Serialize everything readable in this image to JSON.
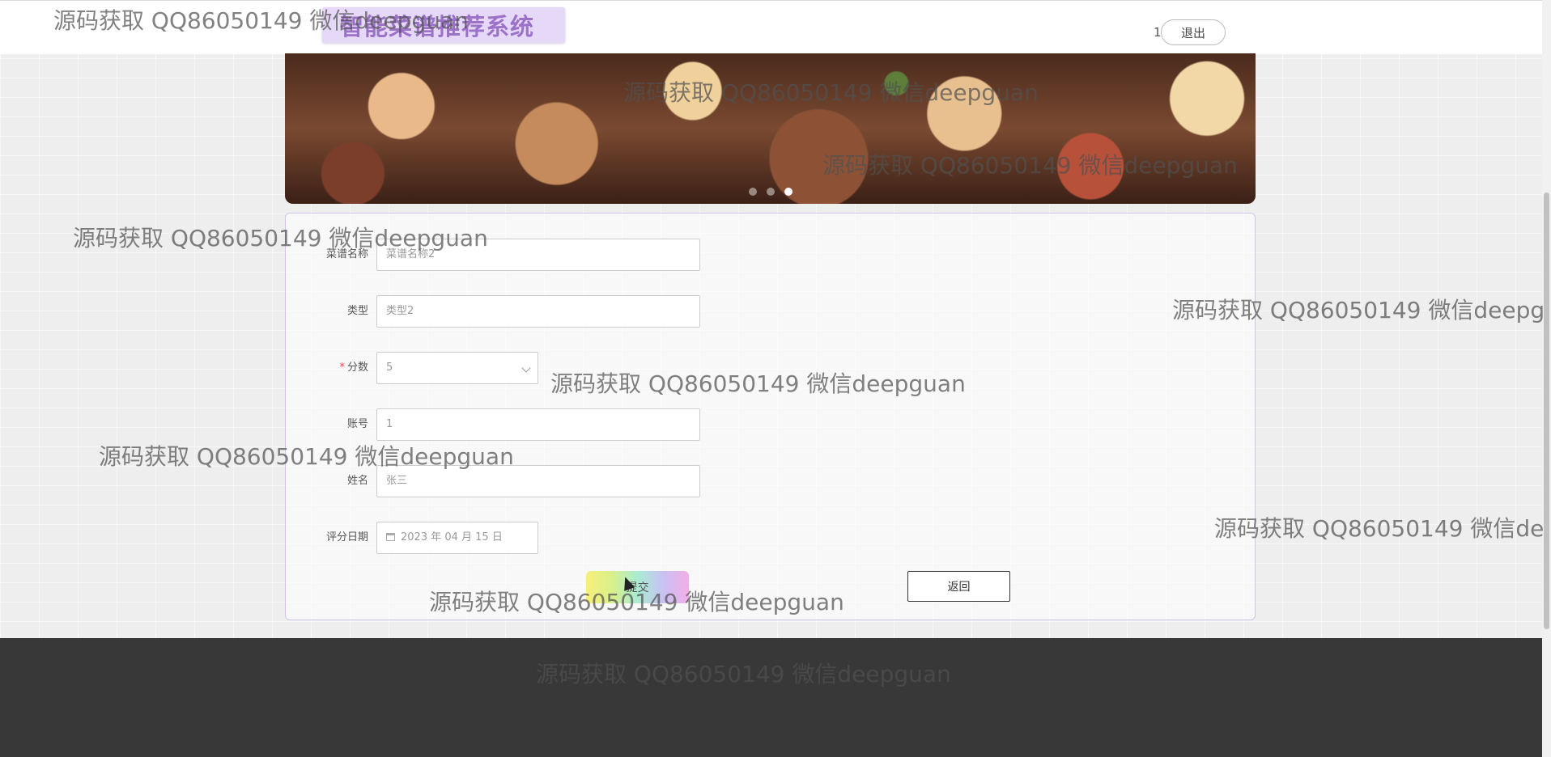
{
  "header": {
    "site_title": "智能菜谱推荐系统",
    "user_id": "1",
    "logout_label": "退出"
  },
  "banner": {
    "slide_count": 3,
    "active_slide": 3
  },
  "form": {
    "fields": [
      {
        "label": "菜谱名称",
        "value": "菜谱名称2",
        "required": false
      },
      {
        "label": "类型",
        "value": "类型2",
        "required": false
      },
      {
        "label": "分数",
        "value": "5",
        "required": true
      },
      {
        "label": "账号",
        "value": "1",
        "required": false
      },
      {
        "label": "姓名",
        "value": "张三",
        "required": false
      },
      {
        "label": "评分日期",
        "value": "2023 年 04 月 15 日",
        "required": false
      }
    ],
    "submit_label": "提交",
    "back_label": "返回"
  },
  "watermark": {
    "texts": [
      "源码获取 QQ86050149 微信deepguan",
      "源码获取 QQ86050149 微信deepguan",
      "源码获取 QQ86050149 微信deepguan",
      "源码获取 QQ86050149 微信deepguan",
      "源码获取 QQ86050149 微信deepg",
      "源码获取 QQ86050149 微信deepguan",
      "源码获取 QQ86050149 微信deepguan",
      "源码获取 QQ86050149 微信de",
      "源码获取 QQ86050149 微信deepguan",
      "源码获取 QQ86050149 微信deepguan"
    ]
  },
  "colors": {
    "title_text": "#9b72c8",
    "title_bg": "#e6d9f7",
    "required_star": "#e84c4c",
    "footer": "#383838",
    "panel_border": "#cfc4e6"
  }
}
